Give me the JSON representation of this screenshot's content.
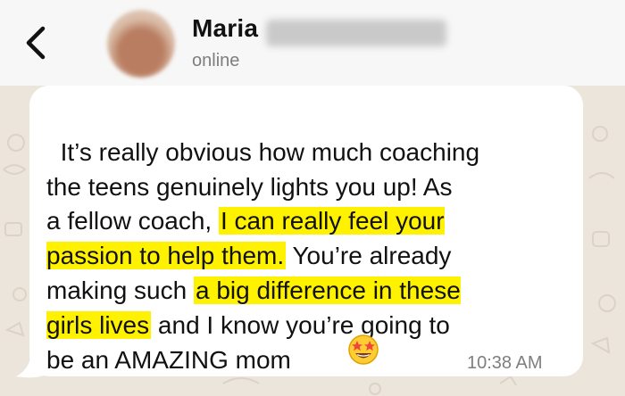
{
  "header": {
    "back_icon": "chevron-left-icon",
    "contact_name": "Maria",
    "status": "online"
  },
  "message": {
    "segments": [
      {
        "text": "It’s really obvious how much coaching\nthe teens genuinely lights you up! As\na fellow coach, ",
        "highlight": false
      },
      {
        "text": "I can really feel your\npassion to help them.",
        "highlight": true
      },
      {
        "text": " You’re already\nmaking such ",
        "highlight": false
      },
      {
        "text": "a big difference in these\ngirls lives",
        "highlight": true
      },
      {
        "text": " and I know you’re going to\nbe an AMAZING mom",
        "highlight": false
      }
    ],
    "emoji": "star-struck-emoji",
    "timestamp": "10:38 AM"
  },
  "colors": {
    "highlight": "#fff200",
    "bubble": "#ffffff",
    "chat_background": "#ece5db",
    "header_background": "#f7f7f7"
  }
}
